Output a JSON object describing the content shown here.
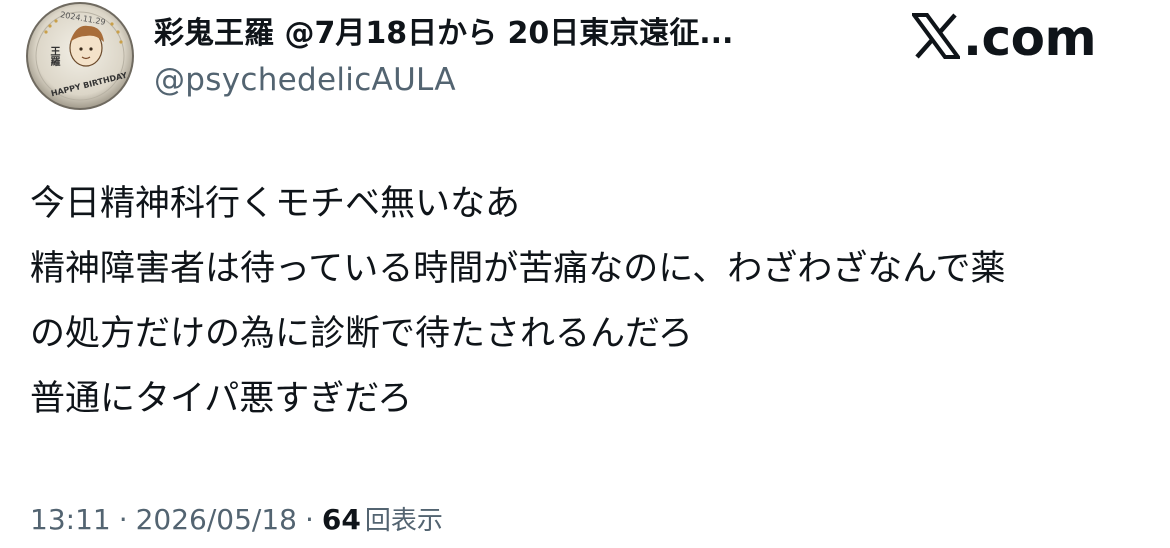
{
  "author": {
    "display_name": "彩鬼王羅 @7月18日から 20日東京遠征...",
    "handle": "@psychedelicAULA",
    "avatar": {
      "icon": "avatar-cake-photo",
      "plaque_name": "王羅",
      "plaque_date": "2024.11.29",
      "plaque_message": "HAPPY BIRTHDAY"
    }
  },
  "site": {
    "label": ".com",
    "icon": "x-logo-icon"
  },
  "tweet": {
    "lines": [
      "今日精神科行くモチベ無いなあ",
      "精神障害者は待っている時間が苦痛なのに、わざわざなんで薬",
      "の処方だけの為に診断で待たされるんだろ",
      "普通にタイパ悪すぎだろ"
    ]
  },
  "meta": {
    "time": "13:11",
    "separator": "·",
    "date": "2026/05/18",
    "views_count": "64",
    "views_label": "回表示"
  },
  "colors": {
    "text": "#0f1419",
    "secondary": "#536471",
    "background": "#ffffff"
  }
}
